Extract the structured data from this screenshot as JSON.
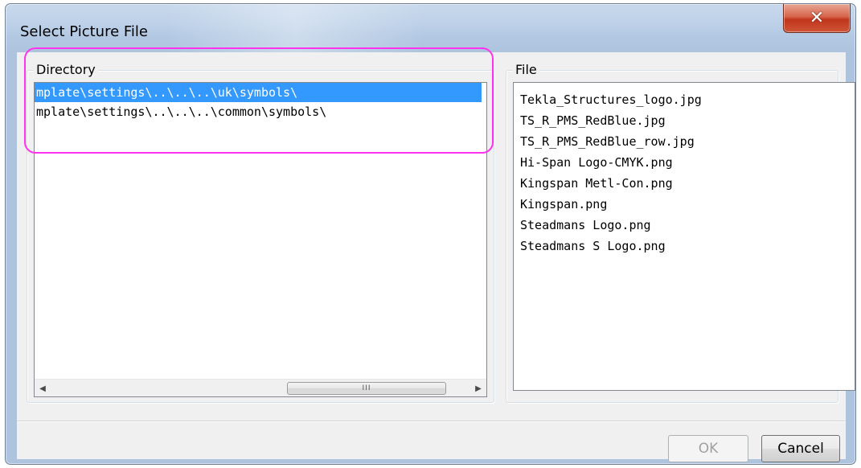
{
  "window": {
    "title": "Select Picture File",
    "close_glyph": "✕"
  },
  "directory": {
    "label": "Directory",
    "items": [
      {
        "text": "mplate\\settings\\..\\..\\..\\uk\\symbols\\",
        "selected": true
      },
      {
        "text": "mplate\\settings\\..\\..\\..\\common\\symbols\\",
        "selected": false
      }
    ],
    "scrollbar": {
      "left_arrow": "◀",
      "right_arrow": "▶",
      "thumb_grip": "III"
    }
  },
  "file": {
    "label": "File",
    "items": [
      "Tekla_Structures_logo.jpg",
      "TS_R_PMS_RedBlue.jpg",
      "TS_R_PMS_RedBlue_row.jpg",
      "Hi-Span Logo-CMYK.png",
      "Kingspan Metl-Con.png",
      "Kingspan.png",
      "Steadmans Logo.png",
      "Steadmans S Logo.png"
    ]
  },
  "buttons": {
    "ok_label": "OK",
    "ok_enabled": false,
    "cancel_label": "Cancel"
  },
  "colors": {
    "selection": "#3399ff",
    "annotation": "#ff33ee",
    "close_button": "#c7432a"
  }
}
